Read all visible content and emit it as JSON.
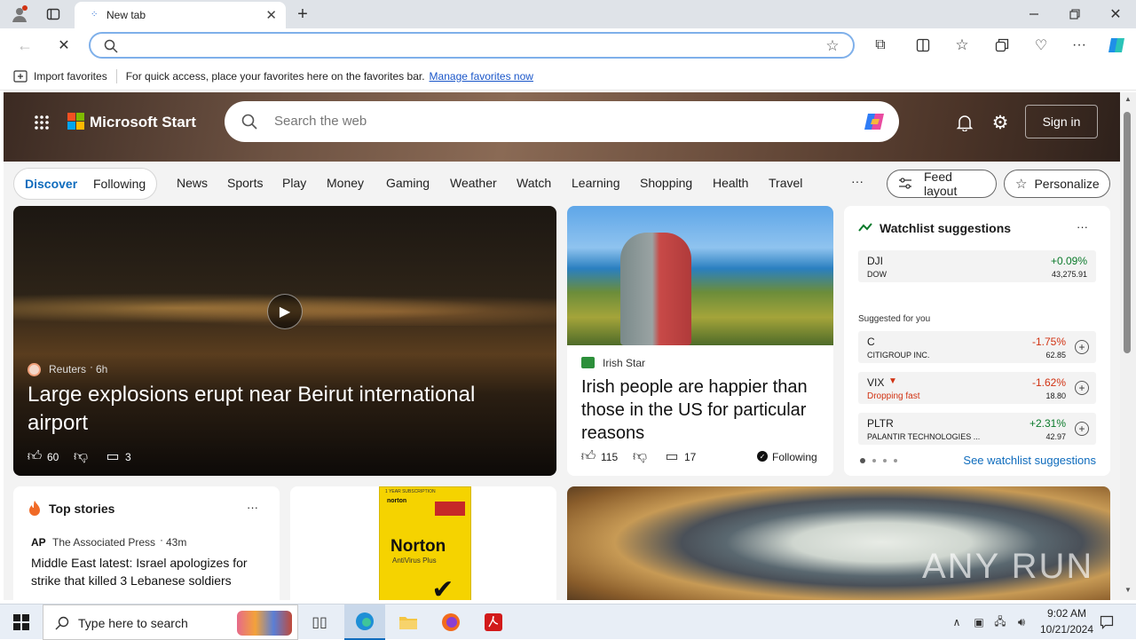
{
  "browser": {
    "tab_title": "New tab",
    "address_value": "",
    "favorites_bar": {
      "import_label": "Import favorites",
      "message": "For quick access, place your favorites here on the favorites bar.",
      "manage_link": "Manage favorites now"
    }
  },
  "msn": {
    "brand": "Microsoft Start",
    "search_placeholder": "Search the web",
    "sign_in": "Sign in",
    "tabs": {
      "discover": "Discover",
      "following": "Following"
    },
    "categories": [
      "News",
      "Sports",
      "Play",
      "Money",
      "Gaming",
      "Weather",
      "Watch",
      "Learning",
      "Shopping",
      "Health",
      "Travel"
    ],
    "more": "···",
    "feed_layout": "Feed layout",
    "personalize": "Personalize"
  },
  "hero_article": {
    "source": "Reuters",
    "time": "6h",
    "title": "Large explosions erupt near Beirut international airport",
    "likes": "60",
    "comments": "3"
  },
  "second_article": {
    "source": "Irish Star",
    "title": "Irish people are happier than those in the US for particular reasons",
    "likes": "115",
    "comments": "17",
    "following": "Following"
  },
  "watchlist": {
    "title": "Watchlist suggestions",
    "menu": "···",
    "main": {
      "symbol": "DJI",
      "name": "DOW",
      "change": "+0.09%",
      "price": "43,275.91"
    },
    "suggested_label": "Suggested for you",
    "items": [
      {
        "symbol": "C",
        "name": "CITIGROUP INC.",
        "change": "-1.75%",
        "price": "62.85"
      },
      {
        "symbol": "VIX",
        "name": "Dropping fast",
        "change": "-1.62%",
        "price": "18.80"
      },
      {
        "symbol": "PLTR",
        "name": "PALANTIR TECHNOLOGIES ...",
        "change": "+2.31%",
        "price": "42.97"
      }
    ],
    "see_more": "See watchlist suggestions",
    "colors": {
      "up": "#0b7a2b",
      "down": "#d13212"
    }
  },
  "top_stories": {
    "title": "Top stories",
    "menu": "···",
    "source_logo": "AP",
    "source": "The Associated Press",
    "time": "43m",
    "headline": "Middle East latest: Israel apologizes for strike that killed 3 Lebanese soldiers"
  },
  "ad": {
    "banner": "1 YEAR SUBSCRIPTION",
    "brand_small": "norton",
    "brand": "Norton",
    "product": "AntiVirus Plus"
  },
  "watermark": "ANY RUN",
  "taskbar": {
    "search_placeholder": "Type here to search",
    "time": "9:02 AM",
    "date": "10/21/2024"
  }
}
